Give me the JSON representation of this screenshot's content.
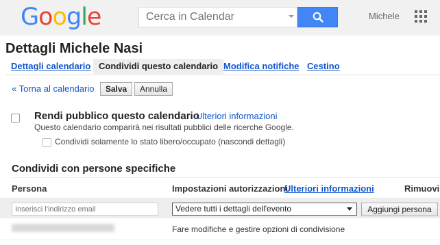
{
  "header": {
    "logo_letters": [
      {
        "ch": "G",
        "color": "#4285f4"
      },
      {
        "ch": "o",
        "color": "#ea4335"
      },
      {
        "ch": "o",
        "color": "#fbbc05"
      },
      {
        "ch": "g",
        "color": "#4285f4"
      },
      {
        "ch": "l",
        "color": "#34a853"
      },
      {
        "ch": "e",
        "color": "#ea4335"
      }
    ],
    "search_placeholder": "Cerca in Calendar",
    "search_icon": "search-icon",
    "user_name": "Michele",
    "apps_icon": "apps-grid-icon"
  },
  "page": {
    "title": "Dettagli Michele Nasi"
  },
  "tabs": [
    {
      "label": "Dettagli calendario",
      "selected": false
    },
    {
      "label": "Condividi questo calendario",
      "selected": true
    },
    {
      "label": "Modifica notifiche",
      "selected": false
    },
    {
      "label": "Cestino",
      "selected": false
    }
  ],
  "actions": {
    "back_label": "« Torna al calendario",
    "save_label": "Salva",
    "cancel_label": "Annulla"
  },
  "public_section": {
    "checkbox_label": "Rendi pubblico questo calendario",
    "more_info": "Ulteriori informazioni",
    "description": "Questo calendario comparirà nei risultati pubblici delle ricerche Google.",
    "freebusy_label": "Condividi solamente lo stato libero/occupato (nascondi dettagli)"
  },
  "share_section": {
    "title": "Condividi con persone specifiche",
    "col_person": "Persona",
    "col_permissions": "Impostazioni autorizzazioni",
    "col_permissions_link": "Ulteriori informazioni",
    "col_remove": "Rimuovi",
    "email_placeholder": "Inserisci l'indirizzo email",
    "permission_selected": "Vedere tutti i dettagli dell'evento",
    "add_button": "Aggiungi persona",
    "owner_permission": "Fare modifiche e gestire opzioni di condivisione"
  },
  "colors": {
    "link": "#1155cc",
    "search_button": "#4285f4",
    "topbar_bg": "#f1f1f1"
  }
}
